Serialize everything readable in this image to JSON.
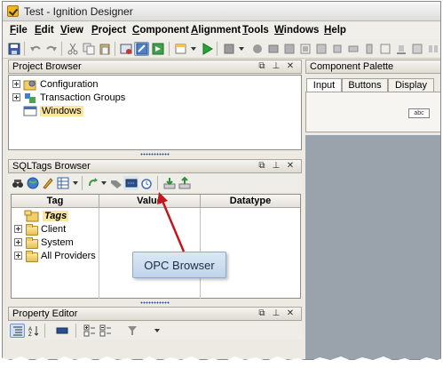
{
  "window": {
    "title": "Test - Ignition Designer"
  },
  "menu": [
    {
      "label": "File",
      "accel": "F",
      "rest": "ile"
    },
    {
      "label": "Edit",
      "accel": "E",
      "rest": "dit"
    },
    {
      "label": "View",
      "accel": "V",
      "rest": "iew"
    },
    {
      "label": "Project",
      "accel": "P",
      "rest": "roject"
    },
    {
      "label": "Component",
      "accel": "C",
      "rest": "omponent"
    },
    {
      "label": "Alignment",
      "accel": "A",
      "rest": "lignment"
    },
    {
      "label": "Tools",
      "accel": "T",
      "rest": "ools"
    },
    {
      "label": "Windows",
      "accel": "W",
      "rest": "indows"
    },
    {
      "label": "Help",
      "accel": "H",
      "rest": "elp"
    }
  ],
  "project_browser": {
    "title": "Project Browser",
    "items": [
      "Configuration",
      "Transaction Groups",
      "Windows"
    ]
  },
  "component_palette": {
    "title": "Component Palette",
    "tabs": [
      "Input",
      "Buttons",
      "Display"
    ],
    "chip_text": "abc"
  },
  "sqltags_browser": {
    "title": "SQLTags Browser",
    "columns": [
      "Tag",
      "Value",
      "Datatype"
    ],
    "items": [
      "Tags",
      "Client",
      "System",
      "All Providers"
    ]
  },
  "property_editor": {
    "title": "Property Editor"
  },
  "callout": {
    "text": "OPC Browser"
  },
  "header_buttons": {
    "restore": "⧉",
    "pin": "⊥",
    "close": "✕"
  },
  "colors": {
    "accent_arrow": "#c0181e",
    "selection": "#fbe6a1",
    "workspace": "#9aa3ab"
  }
}
